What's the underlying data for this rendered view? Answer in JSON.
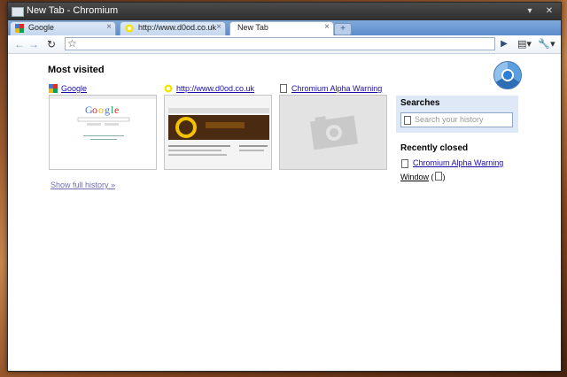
{
  "window": {
    "title": "New Tab - Chromium"
  },
  "tabs": [
    {
      "label": "Google",
      "favicon": "google-favicon",
      "active": false
    },
    {
      "label": "http://www.d0od.co.uk",
      "favicon": "ubuntu-favicon",
      "active": false
    },
    {
      "label": "New Tab",
      "favicon": "",
      "active": true
    }
  ],
  "toolbar": {
    "back_icon": "back-arrow-icon",
    "forward_icon": "forward-arrow-icon",
    "reload_icon": "reload-icon",
    "star_icon": "star-icon",
    "go_icon": "play-icon",
    "page_menu_icon": "page-menu-icon",
    "tools_menu_icon": "wrench-icon",
    "address_value": ""
  },
  "most_visited": {
    "title": "Most visited",
    "items": [
      {
        "title": "Google",
        "favicon": "google-favicon"
      },
      {
        "title": "http://www.d0od.co.uk",
        "favicon": "ubuntu-favicon"
      },
      {
        "title": "Chromium Alpha Warning",
        "favicon": "page-icon"
      }
    ],
    "show_history": "Show full history »"
  },
  "searches": {
    "title": "Searches",
    "placeholder": "Search your history"
  },
  "recently_closed": {
    "title": "Recently closed",
    "items": [
      {
        "label": "Chromium Alpha Warning"
      }
    ],
    "window_label": "Window",
    "window_paren_open": "(",
    "window_paren_close": ")"
  },
  "colors": {
    "accent": "#5b8ccb",
    "link": "#1a0dab",
    "searches_bg": "#dfe8f6"
  }
}
